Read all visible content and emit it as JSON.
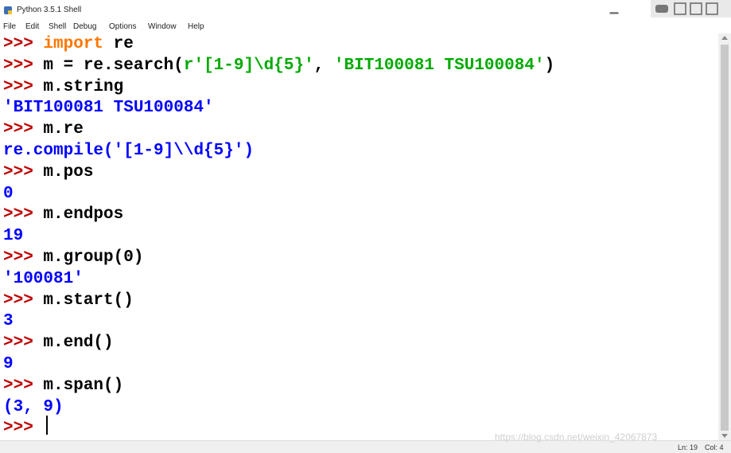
{
  "window": {
    "title": "Python 3.5.1 Shell"
  },
  "menu": [
    "File",
    "Edit",
    "Shell",
    "Debug",
    "Options",
    "Window",
    "Help"
  ],
  "colors": {
    "prompt": "#c00000",
    "keyword": "#ff7700",
    "string": "#00aa00",
    "output": "#0000ff",
    "code": "#000000"
  },
  "shell": {
    "prompt": ">>>",
    "lines": [
      {
        "type": "input",
        "segments": [
          {
            "cls": "kw",
            "text": "import"
          },
          {
            "cls": "code",
            "text": " re"
          }
        ]
      },
      {
        "type": "input",
        "segments": [
          {
            "cls": "code",
            "text": "m = re.search("
          },
          {
            "cls": "str",
            "text": "r'[1-9]\\d{5}'"
          },
          {
            "cls": "code",
            "text": ", "
          },
          {
            "cls": "str",
            "text": "'BIT100081 TSU100084'"
          },
          {
            "cls": "code",
            "text": ")"
          }
        ]
      },
      {
        "type": "input",
        "segments": [
          {
            "cls": "code",
            "text": "m.string"
          }
        ]
      },
      {
        "type": "output",
        "text": "'BIT100081 TSU100084'"
      },
      {
        "type": "input",
        "segments": [
          {
            "cls": "code",
            "text": "m.re"
          }
        ]
      },
      {
        "type": "output",
        "text": "re.compile('[1-9]\\\\d{5}')"
      },
      {
        "type": "input",
        "segments": [
          {
            "cls": "code",
            "text": "m.pos"
          }
        ]
      },
      {
        "type": "output",
        "text": "0"
      },
      {
        "type": "input",
        "segments": [
          {
            "cls": "code",
            "text": "m.endpos"
          }
        ]
      },
      {
        "type": "output",
        "text": "19"
      },
      {
        "type": "input",
        "segments": [
          {
            "cls": "code",
            "text": "m.group(0)"
          }
        ]
      },
      {
        "type": "output",
        "text": "'100081'"
      },
      {
        "type": "input",
        "segments": [
          {
            "cls": "code",
            "text": "m.start()"
          }
        ]
      },
      {
        "type": "output",
        "text": "3"
      },
      {
        "type": "input",
        "segments": [
          {
            "cls": "code",
            "text": "m.end()"
          }
        ]
      },
      {
        "type": "output",
        "text": "9"
      },
      {
        "type": "input",
        "segments": [
          {
            "cls": "code",
            "text": "m.span()"
          }
        ]
      },
      {
        "type": "output",
        "text": "(3, 9)"
      },
      {
        "type": "input",
        "segments": []
      }
    ]
  },
  "status": {
    "ln": "Ln: 19",
    "col": "Col: 4"
  },
  "watermark": "https://blog.csdn.net/weixin_42067873",
  "icons": {
    "app": "python-idle-icon",
    "minimize": "minimize-icon"
  }
}
